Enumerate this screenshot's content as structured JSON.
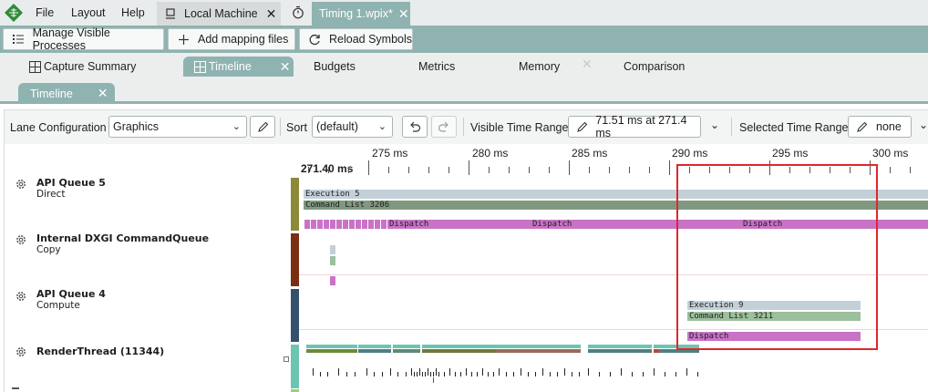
{
  "menu": {
    "file": "File",
    "layout": "Layout",
    "help": "Help"
  },
  "doc_tabs": {
    "local_machine": "Local Machine",
    "timing": "Timing 1.wpix*"
  },
  "toolbar": {
    "manage_processes": "Manage Visible Processes",
    "add_mapping": "Add mapping files",
    "reload_symbols": "Reload Symbols"
  },
  "pane_tabs": {
    "capture_summary": "Capture Summary",
    "timeline": "Timeline",
    "budgets": "Budgets",
    "metrics": "Metrics",
    "memory": "Memory",
    "comparison": "Comparison"
  },
  "sub_tab": {
    "timeline": "Timeline"
  },
  "config": {
    "lane_configuration_label": "Lane Configuration",
    "lane_configuration_value": "Graphics",
    "sort_label": "Sort",
    "sort_value": "(default)",
    "visible_range_label": "Visible Time Range:",
    "visible_range_value": "71.51 ms at 271.4 ms",
    "selected_range_label": "Selected Time Range:",
    "selected_range_value": "none"
  },
  "ruler": {
    "start": "271.40 ms",
    "ticks": [
      "275 ms",
      "280 ms",
      "285 ms",
      "290 ms",
      "295 ms",
      "300 ms"
    ]
  },
  "lanes": [
    {
      "name": "API Queue 5",
      "sub": "Direct",
      "color": "#8c8a3a"
    },
    {
      "name": "Internal DXGI CommandQueue",
      "sub": "Copy",
      "color": "#7a2e14"
    },
    {
      "name": "API Queue 4",
      "sub": "Compute",
      "color": "#34506e"
    },
    {
      "name": "RenderThread (11344)",
      "sub": "",
      "color": "#6cc5b1"
    }
  ],
  "events": {
    "execution_5": "Execution 5",
    "command_list_3206": "Command List 3206",
    "dispatch": "Dispatch",
    "execution_9": "Execution 9",
    "command_list_3211": "Command List 3211"
  },
  "colors": {
    "accent": "#8fb3b0",
    "execution": "#c4d0d8",
    "command_list": "#7f9980",
    "dispatch": "#c873c6",
    "selection": "#e0262b"
  }
}
